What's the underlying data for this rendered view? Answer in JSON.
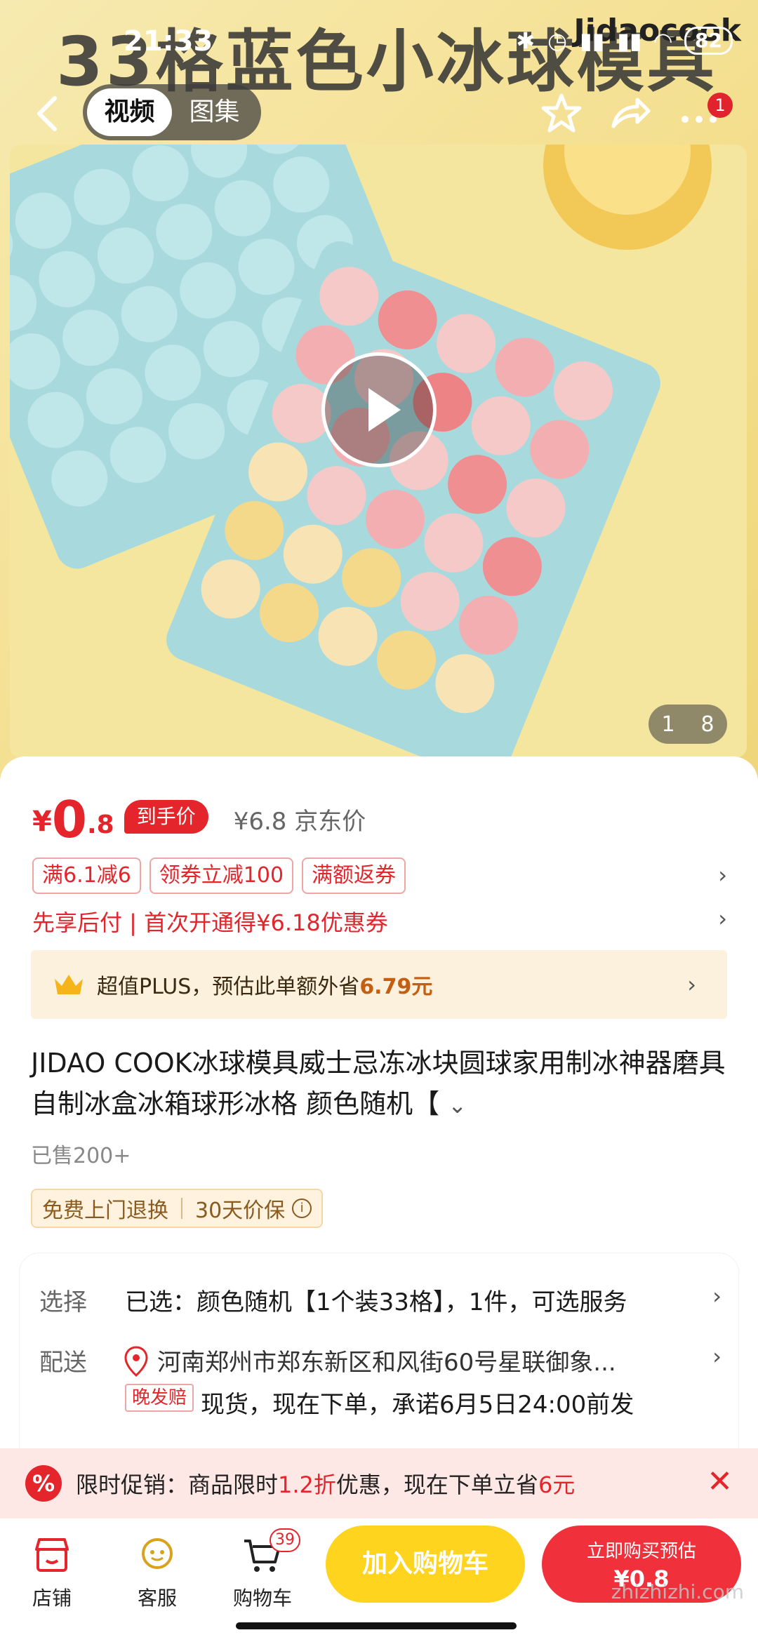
{
  "status_bar": {
    "time": "21:33",
    "battery": "82"
  },
  "hero": {
    "overlay_title": "33格蓝色小冰球模具",
    "brand": "Jidaocook",
    "image_index": "1",
    "image_total": "8"
  },
  "nav": {
    "tabs": [
      {
        "label": "视频",
        "active": true
      },
      {
        "label": "图集",
        "active": false
      }
    ],
    "notification_count": "1"
  },
  "price": {
    "currency": "¥",
    "integer": "0",
    "decimal": ".8",
    "tag": "到手价",
    "original": "¥6.8 京东价"
  },
  "coupons": [
    "满6.1减6",
    "领券立减100",
    "满额返券"
  ],
  "pay_later": "先享后付 | 首次开通得¥6.18优惠券",
  "plus": {
    "text": "超值PLUS，预估此单额外省",
    "amount": "6.79元"
  },
  "product": {
    "title": "JIDAO COOK冰球模具威士忌冻冰块圆球家用制冰神器磨具自制冰盒冰箱球形冰格 颜色随机【",
    "sold": "已售200+"
  },
  "services": [
    "免费上门退换",
    "30天价保"
  ],
  "spec": {
    "select_label": "选择",
    "select_value": "已选：颜色随机【1个装33格】，1件，可选服务",
    "delivery_label": "配送",
    "delivery_address": "河南郑州市郑东新区和风街60号星联御象...",
    "late_tag": "晚发赔",
    "delivery_promise": "现货，现在下单，承诺6月5日24:00前发"
  },
  "promo": {
    "prefix": "限时促销：商品限时",
    "discount": "1.2折",
    "middle": "优惠，现在下单立省",
    "save": "6元"
  },
  "bottom_bar": {
    "shop": "店铺",
    "service": "客服",
    "cart": "购物车",
    "cart_count": "39",
    "add_to_cart": "加入购物车",
    "buy_line1": "立即购买预估",
    "buy_line2": "¥0.8"
  },
  "watermark": "zhizhizhi.com",
  "colors": {
    "accent_red": "#e4262c",
    "cart_yellow": "#ffd41f",
    "buy_red": "#f0303a"
  }
}
